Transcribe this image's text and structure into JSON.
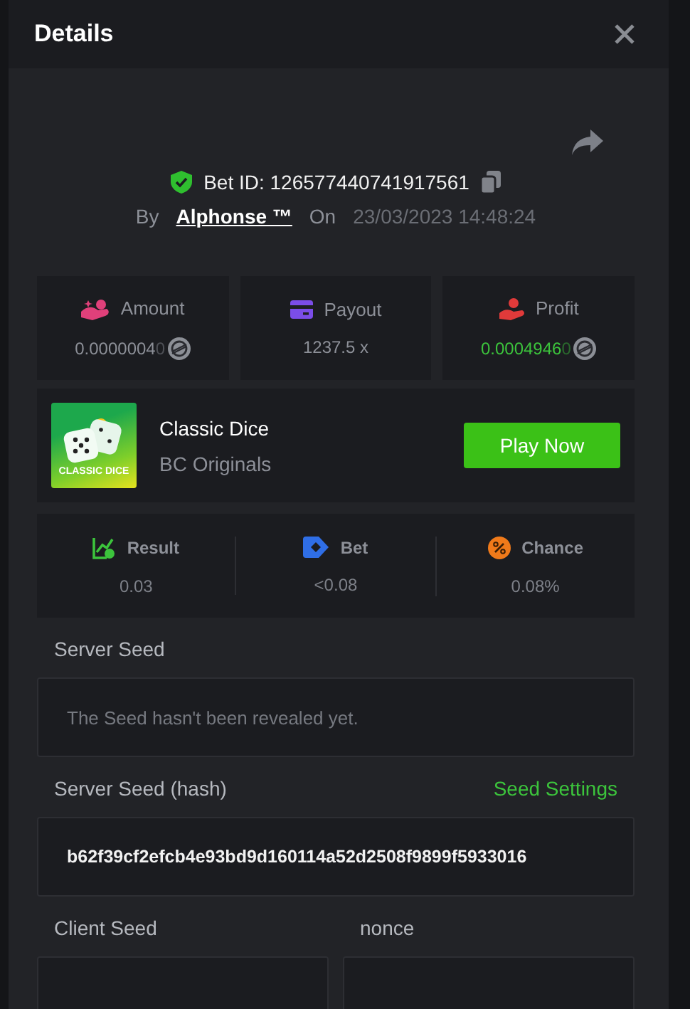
{
  "window": {
    "title": "Details"
  },
  "bet": {
    "id_label": "Bet ID: 126577440741917561",
    "by_label": "By",
    "user": "Alphonse ™",
    "on_label": "On",
    "date": "23/03/2023 14:48:24"
  },
  "stats": [
    {
      "kind": "amount",
      "label": "Amount",
      "value": "0.0000004",
      "value_tail": "0",
      "coin": true,
      "positive": false
    },
    {
      "kind": "payout",
      "label": "Payout",
      "value": "1237.5 x",
      "coin": false,
      "positive": false
    },
    {
      "kind": "profit",
      "label": "Profit",
      "value": "0.0004946",
      "value_tail": "0",
      "coin": true,
      "positive": true
    }
  ],
  "game": {
    "thumb_text": "CLASSIC DICE",
    "name": "Classic Dice",
    "provider": "BC Originals",
    "button": "Play Now"
  },
  "results": [
    {
      "kind": "result",
      "label": "Result",
      "value": "0.03"
    },
    {
      "kind": "bet",
      "label": "Bet",
      "value": "<0.08"
    },
    {
      "kind": "chance",
      "label": "Chance",
      "value": "0.08%"
    }
  ],
  "server_seed": {
    "label": "Server Seed",
    "placeholder": "The Seed hasn't been revealed yet."
  },
  "server_hash": {
    "label": "Server Seed (hash)",
    "link": "Seed Settings",
    "value": "b62f39cf2efcb4e93bd9d160114a52d2508f9899f5933016"
  },
  "client_seed": {
    "label": "Client Seed"
  },
  "nonce": {
    "label": "nonce"
  }
}
